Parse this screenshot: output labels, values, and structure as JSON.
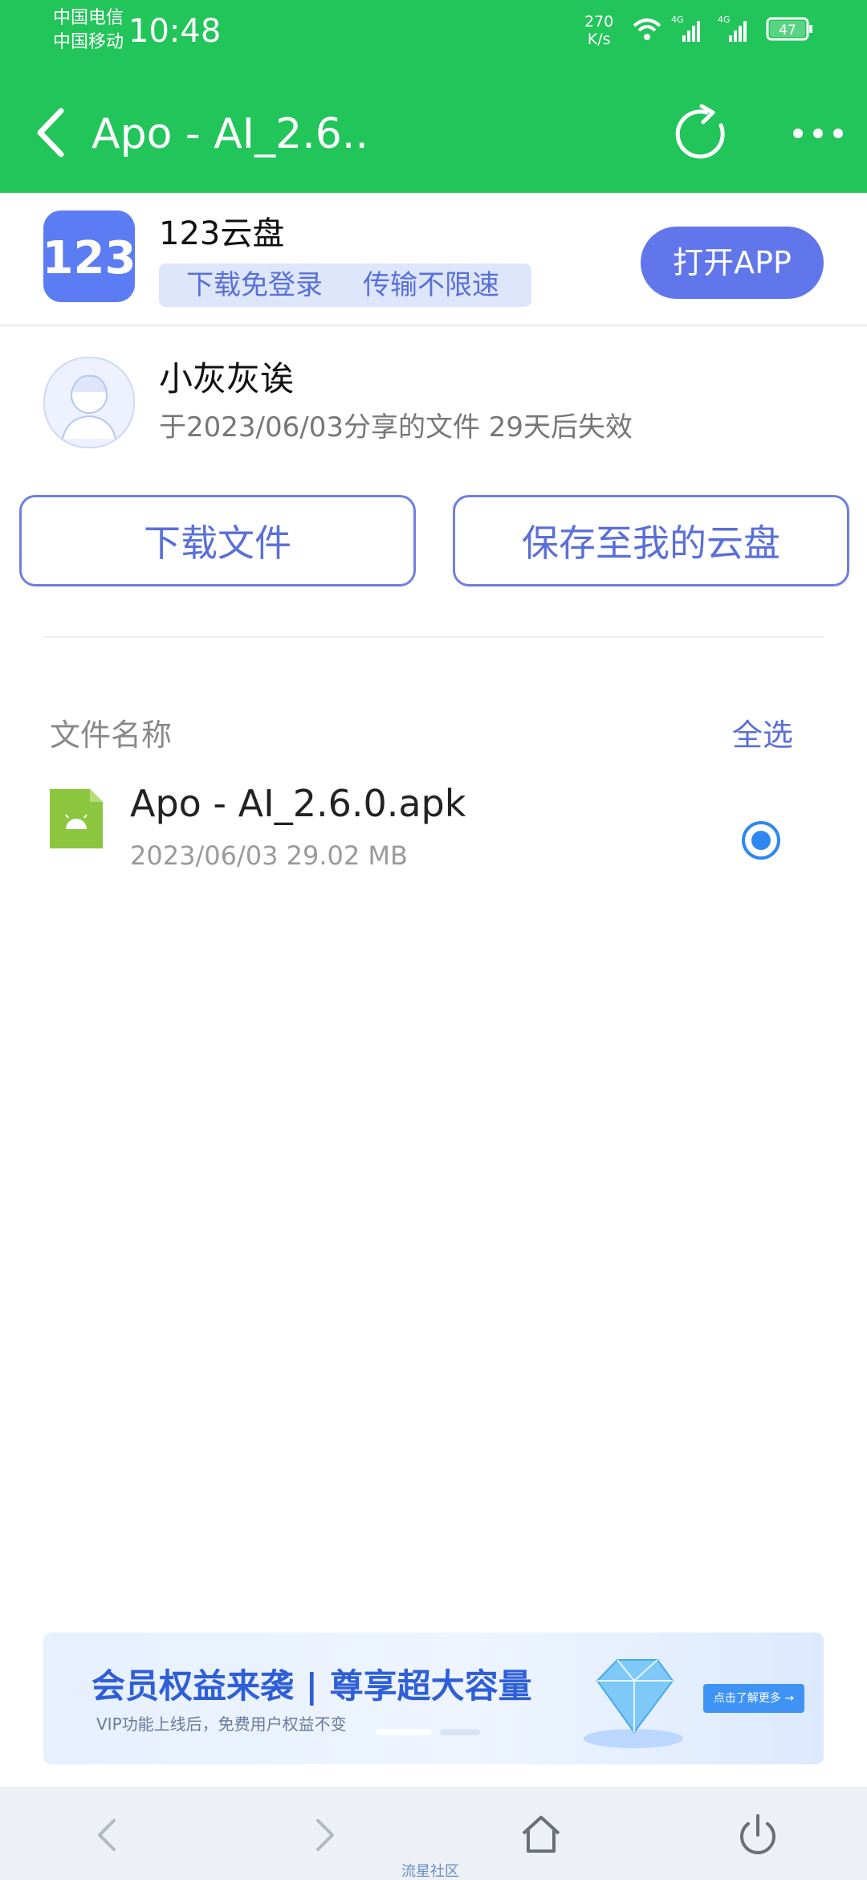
{
  "status_bar": {
    "carrier_1": "中国电信",
    "carrier_2": "中国移动",
    "time": "10:48",
    "net_speed_value": "270",
    "net_speed_unit": "K/s",
    "signal_1": "4G",
    "signal_2": "4G",
    "battery": "47"
  },
  "nav": {
    "title": "Apo - AI_2.6.."
  },
  "app_banner": {
    "logo_text": "123",
    "name": "123云盘",
    "tag_1": "下载免登录",
    "tag_2": "传输不限速",
    "open_button": "打开APP"
  },
  "share": {
    "sharer_name": "小灰灰诶",
    "info": "于2023/06/03分享的文件 29天后失效"
  },
  "actions": {
    "download": "下载文件",
    "save": "保存至我的云盘"
  },
  "file_list": {
    "header": "文件名称",
    "select_all": "全选",
    "files": [
      {
        "name": "Apo - AI_2.6.0.apk",
        "meta": "2023/06/03 29.02 MB",
        "selected": true
      }
    ]
  },
  "ad": {
    "title": "会员权益来袭 | 尊享超大容量",
    "subtitle": "VIP功能上线后，免费用户权益不变",
    "cta": "点击了解更多 →"
  },
  "bottom_nav": {
    "caption": "流星社区"
  },
  "colors": {
    "header_green": "#22c55a",
    "accent_blue": "#6276ec",
    "apk_green": "#8cc63f",
    "radio_blue": "#2f88f0"
  }
}
